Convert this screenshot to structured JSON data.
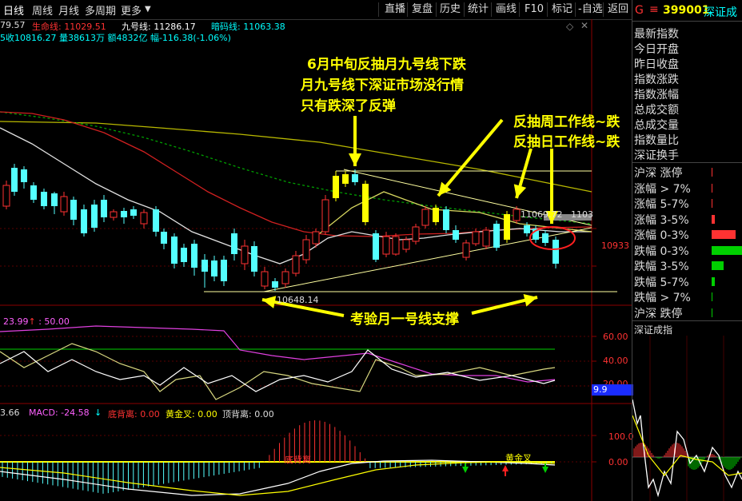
{
  "toolbar": {
    "tabs": [
      "日线",
      "周线",
      "月线",
      "多周期",
      "更多"
    ],
    "buttons": [
      "直播",
      "复盘",
      "历史",
      "统计",
      "画线",
      "F10",
      "标记",
      "-自选",
      "返回"
    ]
  },
  "info_line1": {
    "prefix": "79.57",
    "life_label": "生命线: 11029.51",
    "nine_label": "九号线: 11286.17",
    "code_label": "暗码线: 11063.38"
  },
  "info_line2": {
    "text": "5收10816.27 量38613万 额4832亿 幅-116.38(-1.06%)"
  },
  "annotations": {
    "top1": "6月中旬反抽月九号线下跌",
    "top2": "月九号线下深证市场没行情",
    "top3": "只有跌深了反弹",
    "right1": "反抽周工作线~跌",
    "right2": "反抽日工作线~跌",
    "bottom": "考验月一号线支撑"
  },
  "price_labels": {
    "low": "10648.14",
    "high": "11069.72",
    "high_right": "1103",
    "right_axis": "10933"
  },
  "rsi": {
    "label_prefix": "23.99",
    "label_value": "50.00",
    "axis": [
      "60.00",
      "40.00",
      "20.00"
    ],
    "badge": "9.9"
  },
  "macd": {
    "prefix": "3.66",
    "macd_label": "MACD: -24.58",
    "bottom_div": "底背离: 0.00",
    "gold_cross": "黄金叉: 0.00",
    "top_div": "顶背离: 0.00",
    "chart_label1": "底背离",
    "chart_label2": "黄金叉",
    "axis": [
      "100.0",
      "0.00"
    ]
  },
  "right_panel": {
    "code": "399001",
    "name": "深证成",
    "rows": [
      "最新指数",
      "今日开盘",
      "昨日收盘",
      "指数涨跌",
      "指数涨幅",
      "总成交额",
      "总成交量",
      "指数量比",
      "深证换手"
    ],
    "breadth": [
      "沪深 涨停",
      "涨幅 > 7%",
      "涨幅 5-7%",
      "涨幅 3-5%",
      "涨幅 0-3%",
      "跌幅 0-3%",
      "跌幅 3-5%",
      "跌幅 5-7%",
      "跌幅 > 7%",
      "沪深 跌停"
    ],
    "breadth_values": [
      0.01,
      0.01,
      0.01,
      0.1,
      0.8,
      1.0,
      0.4,
      0.1,
      0.02,
      0.01
    ],
    "mini_title": "深证成指"
  },
  "colors": {
    "up": "#ff3232",
    "down": "#54ffff",
    "yellow": "#ffff00",
    "green": "#00d000"
  }
}
